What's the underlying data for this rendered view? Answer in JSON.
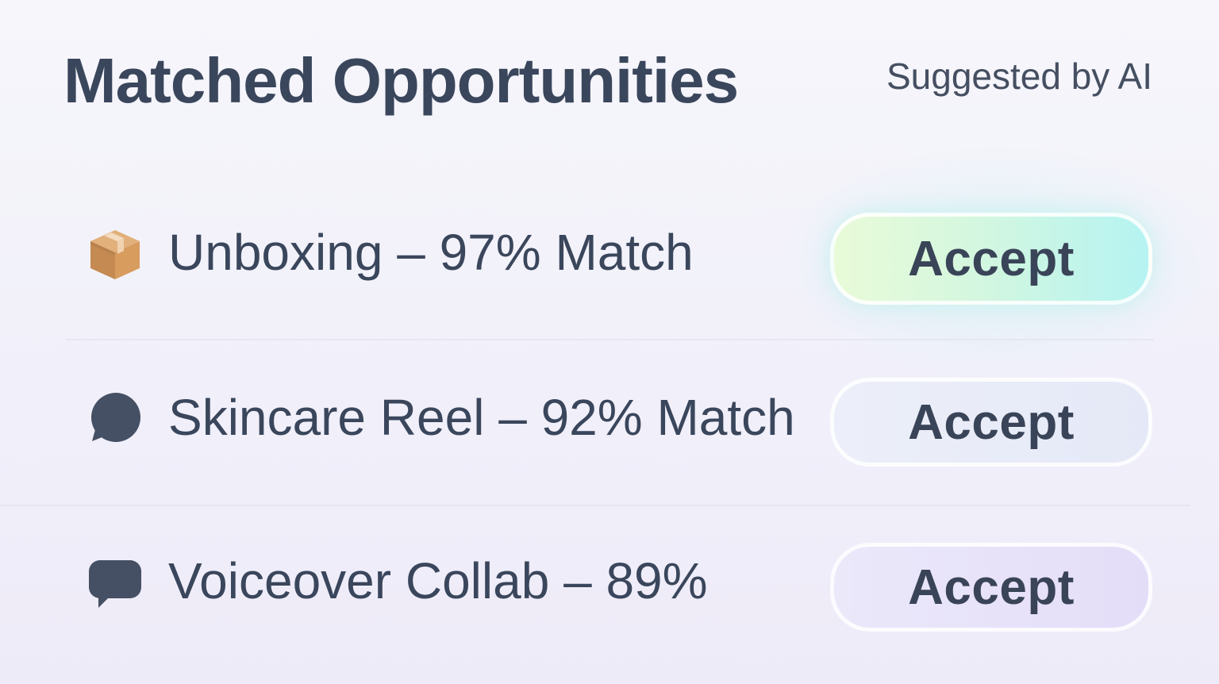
{
  "header": {
    "title": "Matched Opportunities",
    "subtitle": "Suggested by AI"
  },
  "opportunities": [
    {
      "icon": "package-icon",
      "label": "Unboxing – 97% Match",
      "match_percent": 97,
      "button_label": "Accept",
      "button_state": "highlighted"
    },
    {
      "icon": "speech-bubble-icon",
      "label": "Skincare Reel – 92% Match",
      "match_percent": 92,
      "button_label": "Accept",
      "button_state": "default"
    },
    {
      "icon": "chat-bubble-icon",
      "label": "Voiceover Collab – 89%",
      "match_percent": 89,
      "button_label": "Accept",
      "button_state": "default"
    }
  ],
  "colors": {
    "text": "#3a465b",
    "accent_gradient_start": "#e9fbd8",
    "accent_gradient_end": "#b5f3f2",
    "button_neutral": "#e5e9f7",
    "button_lavender": "#e4ddf8"
  }
}
